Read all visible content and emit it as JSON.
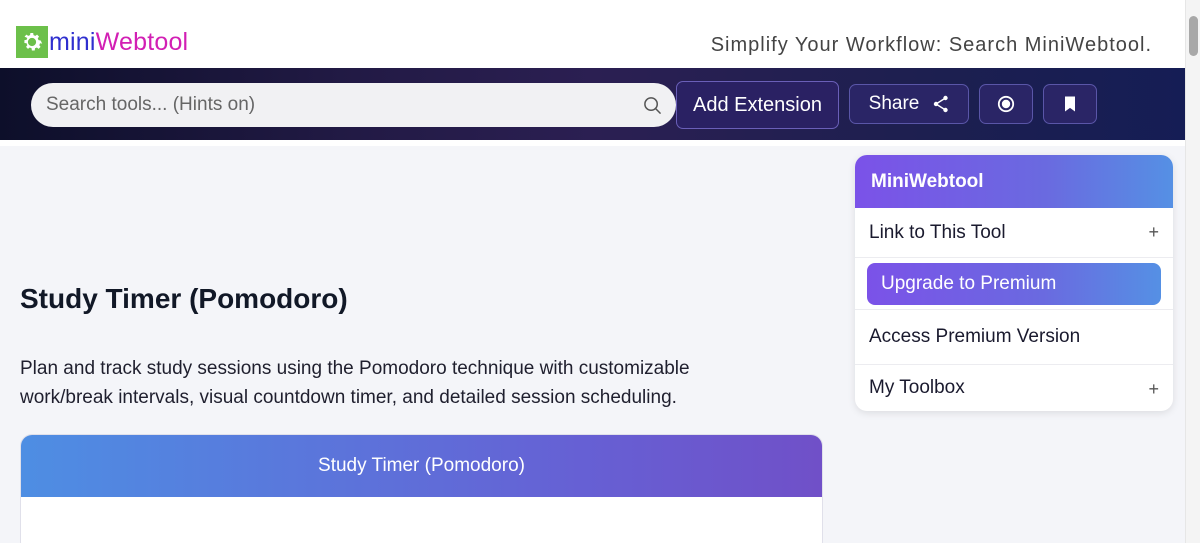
{
  "header": {
    "logo_mini": "mini",
    "logo_webtool": "Webtool",
    "tagline": "Simplify Your Workflow: Search MiniWebtool."
  },
  "navbar": {
    "search_placeholder": "Search tools... (Hints on)",
    "add_extension_label": "Add Extension",
    "share_label": "Share"
  },
  "main": {
    "title": "Study Timer (Pomodoro)",
    "description": "Plan and track study sessions using the Pomodoro technique with customizable work/break intervals, visual countdown timer, and detailed session scheduling.",
    "card_title": "Study Timer (Pomodoro)"
  },
  "sidebar": {
    "title": "MiniWebtool",
    "items": [
      {
        "label": "Link to This Tool",
        "expand": "+"
      },
      {
        "label": "Upgrade to Premium"
      },
      {
        "label": "Access Premium Version"
      },
      {
        "label": "My Toolbox",
        "expand": "+"
      }
    ]
  },
  "colors": {
    "brand_green": "#6cc04a",
    "logo_blue": "#2f2fcf",
    "logo_magenta": "#d21fb4",
    "accent_purple": "#7b52e8",
    "accent_blue": "#5590e4"
  },
  "icons": [
    "gear-icon",
    "search-icon",
    "share-icon",
    "record-icon",
    "bookmark-icon",
    "plus-icon"
  ]
}
